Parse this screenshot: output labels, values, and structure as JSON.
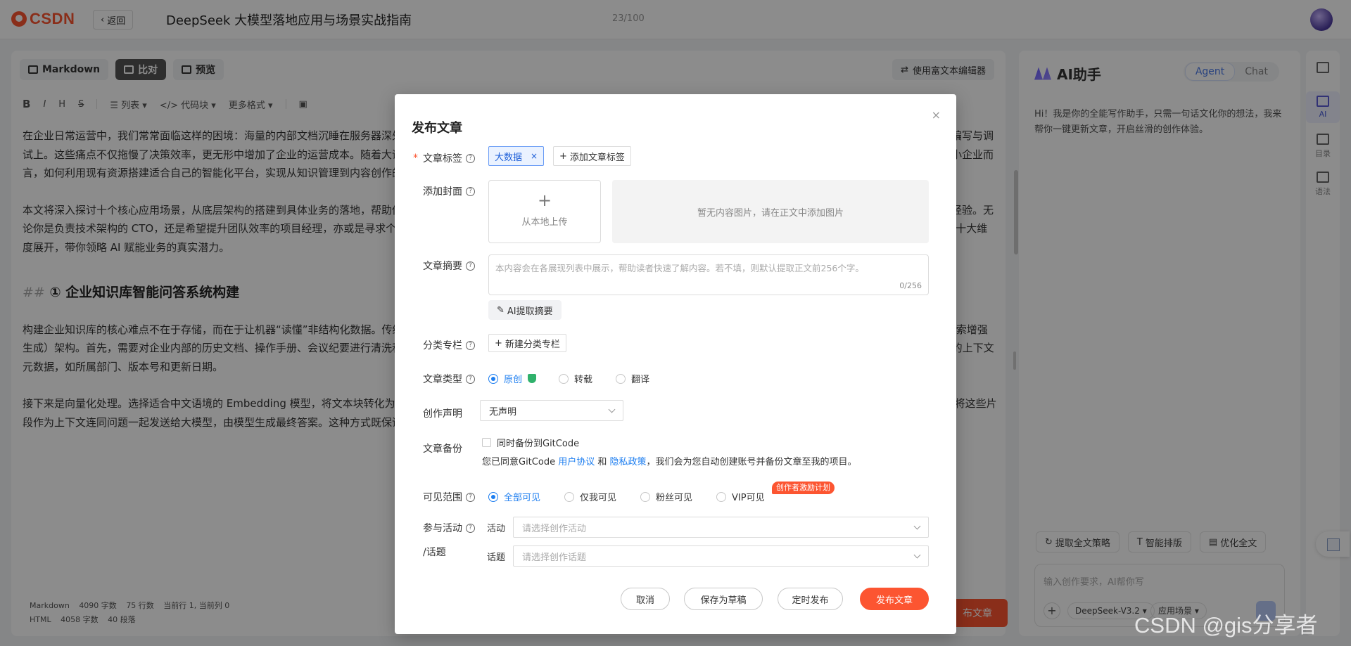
{
  "header": {
    "logo_text": "CSDN",
    "back_label": "返回",
    "title": "DeepSeek 大模型落地应用与场景实战指南",
    "title_count": "23/100"
  },
  "editor": {
    "tabs": [
      "Markdown",
      "比对",
      "预览"
    ],
    "active_tab": "比对",
    "rich_editor_label": "使用富文本编辑器",
    "toolbar": [
      "B",
      "I",
      "H",
      "S",
      "列表",
      "代码块",
      "更多格式"
    ],
    "content": {
      "p1": "在企业日常运营中，我们常常面临这样的困境：海量的内部文档沉睡在服务器深处难以检索，新员工入职培训周期漫长，客服团队被重复性问题淹没，而技术团队则耗费大量时间在 boilerplate 代码的编写与调试上。这些痛点不仅拖慢了决策效率，更无形中增加了企业的运营成本。随着大语言模型技术的成熟，构建一套能够理解业务语境、辅助人工决策的智能系统已不再是大型科技公司的专利。对于广大中小企业而言，如何利用现有资源搭建适合自己的智能化平台，实现从知识管理到内容创作的全链路提效，成为了当前数字化转型的关键课题。",
      "p2": "本文将深入探讨十个核心应用场景，从底层架构的搭建到具体业务的落地，帮助你构建一个既安全又高效的企业级智能助手体系。我们将避开那些晦涩难懂的理论堆砌，专注于可操作的实施步骤与实战经验。无论你是负责技术架构的 CTO，还是希望提升团队效率的项目经理，亦或是寻求个人技能突破的开发者，都能从中找到切实可行的解决方案。内容将围绕知识库构建、代码自动化、文档解析、营销创作等十大维度展开，带你领略 AI 赋能业务的真实潜力。",
      "h2_hash": "##",
      "h2": "① 企业知识库智能问答系统构建",
      "p3": "构建企业知识库的核心难点不在于存储，而在于让机器“读懂”非结构化数据。传统的关键词搜索往往无法理解语义，导致员工在查找制度或技术规范时大海捞针。解决这一问题的关键在于引入 RAG（检索增强生成）架构。首先，需要对企业内部的历史文档、操作手册、会议纪要进行清洗和分块（Chunking）。分块策略不宜过粗也不宜过细，建议按语义段落切割，每块控制在 500-800 字之间，并保留必要的上下文元数据，如所属部门、版本号和更新日期。",
      "p4": "接下来是向量化处理。选择适合中文语境的 Embedding 模型，将文本块转化为向量并存入向量数据库。当用户提问时，系统先将问题向量化，在数据库中进行相似度检索，召回最相关的文档片段，再将这些片段作为上下文连同问题一起发送给大模型，由模型生成最终答案。这种方式既保证了回答的准确性，又有效避免了模型幻觉与内部数据泄露。"
    },
    "status": {
      "line1": [
        "Markdown",
        "4090 字数",
        "75 行数",
        "当前行 1, 当前列 0"
      ],
      "line2": [
        "HTML",
        "4058 字数",
        "40 段落"
      ]
    },
    "publish_behind": "布文章"
  },
  "ai_panel": {
    "title": "AI助手",
    "modes": [
      "Agent",
      "Chat"
    ],
    "active_mode": "Agent",
    "intro": "Hi！我是你的全能写作助手，只需一句话文化你的想法，我来帮你一键更新文章，开启丝滑的创作体验。",
    "actions": [
      "提取全文策略",
      "智能排版",
      "优化全文"
    ],
    "input_placeholder": "输入创作要求，AI帮你写",
    "model": "DeepSeek-V3.2",
    "scene": "应用场景"
  },
  "rail": {
    "items": [
      "AI",
      "目录",
      "语法"
    ]
  },
  "modal": {
    "title": "发布文章",
    "close": "×",
    "tags_label": "文章标签",
    "tag": "大数据",
    "add_tag": "添加文章标签",
    "cover_label": "添加封面",
    "upload_local": "从本地上传",
    "no_images": "暂无内容图片，请在正文中添加图片",
    "abstract_label": "文章摘要",
    "abstract_placeholder": "本内容会在各展现列表中展示，帮助读者快速了解内容。若不填，则默认提取正文前256个字。",
    "abstract_count": "0/256",
    "ai_abstract": "AI提取摘要",
    "column_label": "分类专栏",
    "new_column": "新建分类专栏",
    "type_label": "文章类型",
    "types": [
      "原创",
      "转载",
      "翻译"
    ],
    "selected_type": "原创",
    "statement_label": "创作声明",
    "statement_value": "无声明",
    "backup_label": "文章备份",
    "backup_checkbox": "同时备份到GitCode",
    "gc_note_pre": "您已同意GitCode",
    "gc_link_1": "用户协议",
    "gc_and": "和",
    "gc_link_2": "隐私政策",
    "gc_note_post": "，我们会为您自动创建账号并备份文章至我的项目。",
    "visibility_label": "可见范围",
    "visibility": [
      "全部可见",
      "仅我可见",
      "粉丝可见",
      "VIP可见"
    ],
    "selected_visibility": "全部可见",
    "vip_badge": "创作者激励计划",
    "activity_label": "参与活动",
    "topic_label_suffix": "/话题",
    "activity_sub": "活动",
    "activity_placeholder": "请选择创作活动",
    "topic_sub": "话题",
    "topic_placeholder": "请选择创作话题",
    "buttons": {
      "cancel": "取消",
      "draft": "保存为草稿",
      "schedule": "定时发布",
      "publish": "发布文章"
    }
  },
  "watermark": "CSDN @gis分享者",
  "colors": {
    "brand": "#fc5531",
    "link": "#1d7ef0",
    "tag_bg": "#eaf2ff"
  }
}
